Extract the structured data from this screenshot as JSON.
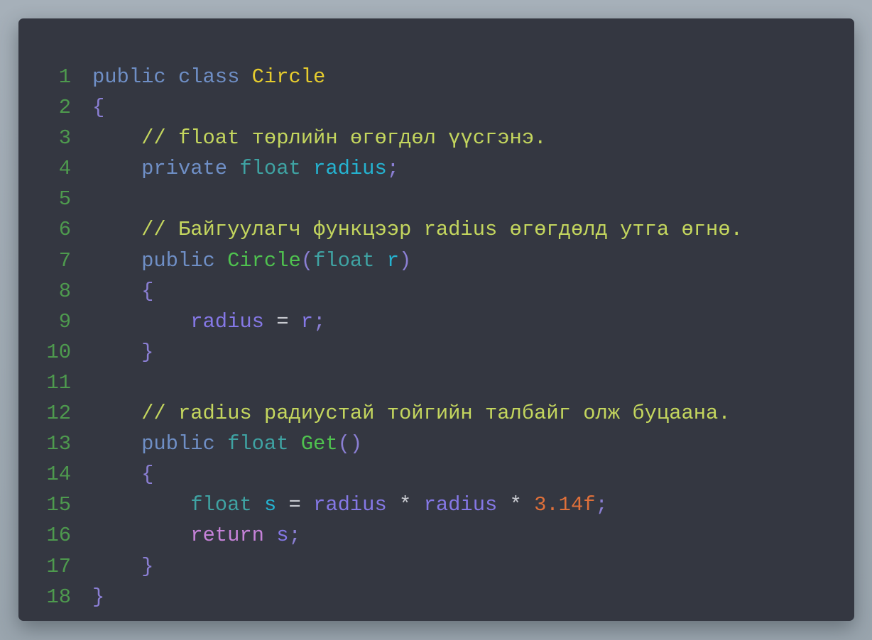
{
  "code_lines": [
    {
      "num": "1",
      "indent": "",
      "tokens": [
        {
          "t": "public",
          "c": "kw"
        },
        {
          "t": " "
        },
        {
          "t": "class",
          "c": "kw"
        },
        {
          "t": " "
        },
        {
          "t": "Circle",
          "c": "cls"
        }
      ]
    },
    {
      "num": "2",
      "indent": "",
      "tokens": [
        {
          "t": "{",
          "c": "pu"
        }
      ]
    },
    {
      "num": "3",
      "indent": "    ",
      "tokens": [
        {
          "t": "// float төрлийн өгөгдөл үүсгэнэ.",
          "c": "com"
        }
      ]
    },
    {
      "num": "4",
      "indent": "    ",
      "tokens": [
        {
          "t": "private",
          "c": "kw"
        },
        {
          "t": " "
        },
        {
          "t": "float",
          "c": "ty"
        },
        {
          "t": " "
        },
        {
          "t": "radius",
          "c": "var"
        },
        {
          "t": ";",
          "c": "pu"
        }
      ]
    },
    {
      "num": "5",
      "indent": "",
      "tokens": []
    },
    {
      "num": "6",
      "indent": "    ",
      "tokens": [
        {
          "t": "// Байгуулагч функцээр radius өгөгдөлд утга өгнө.",
          "c": "com"
        }
      ]
    },
    {
      "num": "7",
      "indent": "    ",
      "tokens": [
        {
          "t": "public",
          "c": "kw"
        },
        {
          "t": " "
        },
        {
          "t": "Circle",
          "c": "fn"
        },
        {
          "t": "(",
          "c": "pu"
        },
        {
          "t": "float",
          "c": "ty"
        },
        {
          "t": " "
        },
        {
          "t": "r",
          "c": "var"
        },
        {
          "t": ")",
          "c": "pu"
        }
      ]
    },
    {
      "num": "8",
      "indent": "    ",
      "tokens": [
        {
          "t": "{",
          "c": "pu"
        }
      ]
    },
    {
      "num": "9",
      "indent": "        ",
      "tokens": [
        {
          "t": "radius",
          "c": "id"
        },
        {
          "t": " "
        },
        {
          "t": "=",
          "c": "op"
        },
        {
          "t": " "
        },
        {
          "t": "r",
          "c": "id"
        },
        {
          "t": ";",
          "c": "pu"
        }
      ]
    },
    {
      "num": "10",
      "indent": "    ",
      "tokens": [
        {
          "t": "}",
          "c": "pu"
        }
      ]
    },
    {
      "num": "11",
      "indent": "",
      "tokens": []
    },
    {
      "num": "12",
      "indent": "    ",
      "tokens": [
        {
          "t": "// radius радиустай тойгийн талбайг олж буцаана.",
          "c": "com"
        }
      ]
    },
    {
      "num": "13",
      "indent": "    ",
      "tokens": [
        {
          "t": "public",
          "c": "kw"
        },
        {
          "t": " "
        },
        {
          "t": "float",
          "c": "ty"
        },
        {
          "t": " "
        },
        {
          "t": "Get",
          "c": "fn"
        },
        {
          "t": "()",
          "c": "pu"
        }
      ]
    },
    {
      "num": "14",
      "indent": "    ",
      "tokens": [
        {
          "t": "{",
          "c": "pu"
        }
      ]
    },
    {
      "num": "15",
      "indent": "        ",
      "tokens": [
        {
          "t": "float",
          "c": "ty"
        },
        {
          "t": " "
        },
        {
          "t": "s",
          "c": "var"
        },
        {
          "t": " "
        },
        {
          "t": "=",
          "c": "op"
        },
        {
          "t": " "
        },
        {
          "t": "radius",
          "c": "id"
        },
        {
          "t": " "
        },
        {
          "t": "*",
          "c": "op"
        },
        {
          "t": " "
        },
        {
          "t": "radius",
          "c": "id"
        },
        {
          "t": " "
        },
        {
          "t": "*",
          "c": "op"
        },
        {
          "t": " "
        },
        {
          "t": "3.14f",
          "c": "num"
        },
        {
          "t": ";",
          "c": "pu"
        }
      ]
    },
    {
      "num": "16",
      "indent": "        ",
      "tokens": [
        {
          "t": "return",
          "c": "ret"
        },
        {
          "t": " "
        },
        {
          "t": "s",
          "c": "id"
        },
        {
          "t": ";",
          "c": "pu"
        }
      ]
    },
    {
      "num": "17",
      "indent": "    ",
      "tokens": [
        {
          "t": "}",
          "c": "pu"
        }
      ]
    },
    {
      "num": "18",
      "indent": "",
      "tokens": [
        {
          "t": "}",
          "c": "pu"
        }
      ]
    }
  ],
  "colors": {
    "background": "#a6b0b9",
    "panel": "#343741",
    "line_number": "#4e9a4e",
    "keyword": "#6f8fc6",
    "type": "#3fa3a3",
    "class_name": "#e6cc2e",
    "function_name": "#4fc24f",
    "punctuation": "#8b7fd4",
    "declared_variable": "#25b3d1",
    "identifier": "#8578e6",
    "comment": "#c4d65e",
    "operator": "#c8cad0",
    "number": "#e0703a",
    "return_keyword": "#c682d9"
  }
}
